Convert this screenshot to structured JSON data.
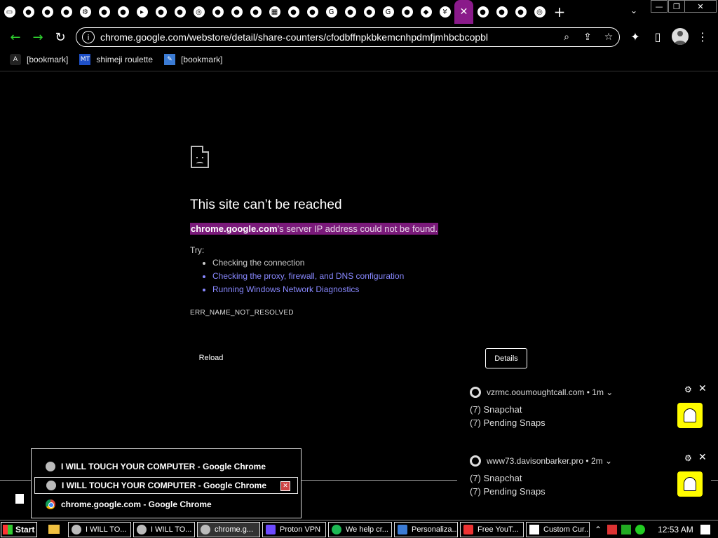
{
  "tabstrip": {
    "tab_glyphs": [
      "▭",
      "●",
      "●",
      "●",
      "⚙",
      "●",
      "●",
      "▸",
      "●",
      "●",
      "◎",
      "●",
      "●",
      "●",
      "▦",
      "●",
      "●",
      "G",
      "●",
      "●",
      "G",
      "●",
      "◆",
      "¥",
      "✕",
      "●",
      "●",
      "●",
      "◎"
    ],
    "new_tab": "+",
    "tab_search": "⌄",
    "window_controls": {
      "minimize": "—",
      "restore": "❐",
      "close": "✕"
    }
  },
  "toolbar": {
    "back": "←",
    "forward": "→",
    "reload": "↻",
    "site_info": "i",
    "url": "chrome.google.com/webstore/detail/share-counters/cfodbffnpkbkemcnhpdmfjmhbcbcopbl",
    "zoom_icon": "⌕",
    "share_icon": "⇪",
    "star_icon": "☆",
    "extensions_icon": "✦",
    "sidepanel_icon": "▯",
    "menu_icon": "⋮"
  },
  "bookmarks": [
    {
      "label": "[bookmark]",
      "icon": "A"
    },
    {
      "label": "shimeji roulette",
      "icon": "MT"
    },
    {
      "label": "[bookmark]",
      "icon": "✎"
    }
  ],
  "error_page": {
    "title": "This site can’t be reached",
    "host": "chrome.google.com",
    "desc_rest": "’s server IP address could not be found.",
    "try_label": "Try:",
    "suggestions": [
      "Checking the connection",
      "Checking the proxy, firewall, and DNS configuration",
      "Running Windows Network Diagnostics"
    ],
    "error_code": "ERR_NAME_NOT_RESOLVED",
    "reload_label": "Reload",
    "details_label": "Details"
  },
  "notifications": [
    {
      "source": "vzrmc.ooumoughtcall.com",
      "age": "• 1m ⌄",
      "line1": "(7) Snapchat",
      "line2": "(7) Pending Snaps"
    },
    {
      "source": "www73.davisonbarker.pro",
      "age": "• 2m ⌄",
      "line1": "(7) Snapchat",
      "line2": "(7) Pending Snaps"
    }
  ],
  "taskbar_popup": {
    "items": [
      "I WILL TOUCH YOUR COMPUTER - Google Chrome",
      "I WILL TOUCH YOUR COMPUTER - Google Chrome",
      "chrome.google.com - Google Chrome"
    ],
    "close_glyph": "✕"
  },
  "taskbar": {
    "start_label": "Start",
    "buttons": [
      "I WILL TO...",
      "I WILL TO...",
      "chrome.g...",
      "Proton VPN",
      "We help cr...",
      "Personaliza...",
      "Free YouT...",
      "Custom Cur..."
    ],
    "clock": "12:53 AM"
  },
  "colors": {
    "accent_tab": "#8a1a8a",
    "highlight": "#7a1a7a",
    "link": "#8888ff",
    "nav_green": "#2fd12f",
    "snapchat_yellow": "#fffc00"
  }
}
